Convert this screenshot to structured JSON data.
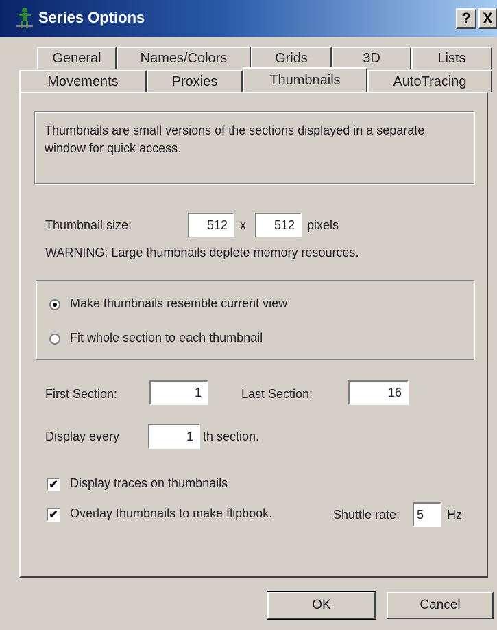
{
  "window": {
    "title": "Series Options",
    "help_label": "?",
    "close_label": "X"
  },
  "tabs": {
    "row1": [
      "General",
      "Names/Colors",
      "Grids",
      "3D",
      "Lists"
    ],
    "row2": [
      "Movements",
      "Proxies",
      "Thumbnails",
      "AutoTracing"
    ],
    "active": "Thumbnails"
  },
  "description": "Thumbnails are small versions of the sections displayed in a separate window for quick access.",
  "thumbnail_size": {
    "label": "Thumbnail size:",
    "width": "512",
    "separator": "x",
    "height": "512",
    "unit": "pixels",
    "warning": "WARNING: Large thumbnails deplete memory resources."
  },
  "view_mode": {
    "options": [
      "Make thumbnails resemble current view",
      "Fit whole section to each thumbnail"
    ],
    "selected": "Make thumbnails resemble current view"
  },
  "sections": {
    "first_label": "First Section:",
    "first_value": "1",
    "last_label": "Last Section:",
    "last_value": "16",
    "every_label": "Display every",
    "every_value": "1",
    "every_suffix": "th section."
  },
  "options": {
    "display_traces_label": "Display traces on thumbnails",
    "display_traces_checked": true,
    "overlay_label": "Overlay thumbnails to make flipbook.",
    "overlay_checked": true,
    "shuttle_label": "Shuttle rate:",
    "shuttle_value": "5",
    "shuttle_unit": "Hz"
  },
  "buttons": {
    "ok": "OK",
    "cancel": "Cancel"
  },
  "icons": {
    "app": "person-icon",
    "help": "help-icon",
    "close": "close-icon",
    "check": "checkmark-icon"
  }
}
